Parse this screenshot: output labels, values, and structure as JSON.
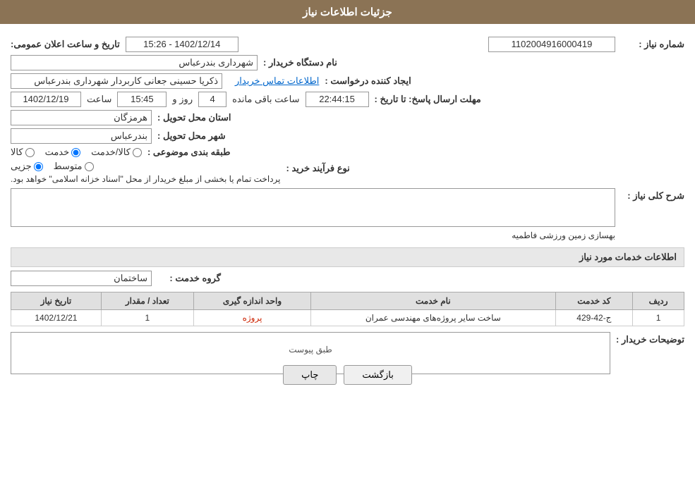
{
  "header": {
    "title": "جزئیات اطلاعات نیاز"
  },
  "fields": {
    "need_number_label": "شماره نیاز :",
    "need_number_value": "1102004916000419",
    "announcement_date_label": "تاریخ و ساعت اعلان عمومی:",
    "announcement_date_value": "1402/12/14 - 15:26",
    "buyer_org_label": "نام دستگاه خریدار :",
    "buyer_org_value": "شهرداری بندرعباس",
    "creator_label": "ایجاد کننده درخواست :",
    "creator_value": "ذکریا حسینی جعانی کاربردار شهرداری بندرعباس",
    "contact_link": "اطلاعات تماس خریدار",
    "response_deadline_label": "مهلت ارسال پاسخ: تا تاریخ :",
    "response_date": "1402/12/19",
    "response_time_label": "ساعت",
    "response_time": "15:45",
    "response_days_label": "روز و",
    "response_days": "4",
    "response_remaining_label": "ساعت باقی مانده",
    "response_remaining": "22:44:15",
    "province_label": "استان محل تحویل :",
    "province_value": "هرمزگان",
    "city_label": "شهر محل تحویل :",
    "city_value": "بندرعباس",
    "subject_label": "طبقه بندی موضوعی :",
    "subject_options": [
      "کالا",
      "خدمت",
      "کالا/خدمت"
    ],
    "subject_selected": "خدمت",
    "purchase_type_label": "نوع فرآیند خرید :",
    "purchase_type_options": [
      "جزیی",
      "متوسط"
    ],
    "purchase_note": "پرداخت تمام یا بخشی از مبلغ خریدار از محل \"اسناد خزانه اسلامی\" خواهد بود.",
    "description_label": "شرح کلی نیاز :",
    "description_value": "بهسازی زمین ورزشی فاطمیه",
    "services_section_title": "اطلاعات خدمات مورد نیاز",
    "service_group_label": "گروه خدمت :",
    "service_group_value": "ساختمان",
    "table_headers": [
      "ردیف",
      "کد خدمت",
      "نام خدمت",
      "واحد اندازه گیری",
      "تعداد / مقدار",
      "تاریخ نیاز"
    ],
    "table_rows": [
      {
        "row": "1",
        "code": "ج-42-429",
        "name": "ساخت سایر پروژه‌های مهندسی عمران",
        "unit": "پروژه",
        "quantity": "1",
        "date": "1402/12/21"
      }
    ],
    "buyer_desc_label": "توضیحات خریدار :",
    "buyer_desc_placeholder": "طبق پیوست",
    "btn_print": "چاپ",
    "btn_back": "بازگشت"
  }
}
